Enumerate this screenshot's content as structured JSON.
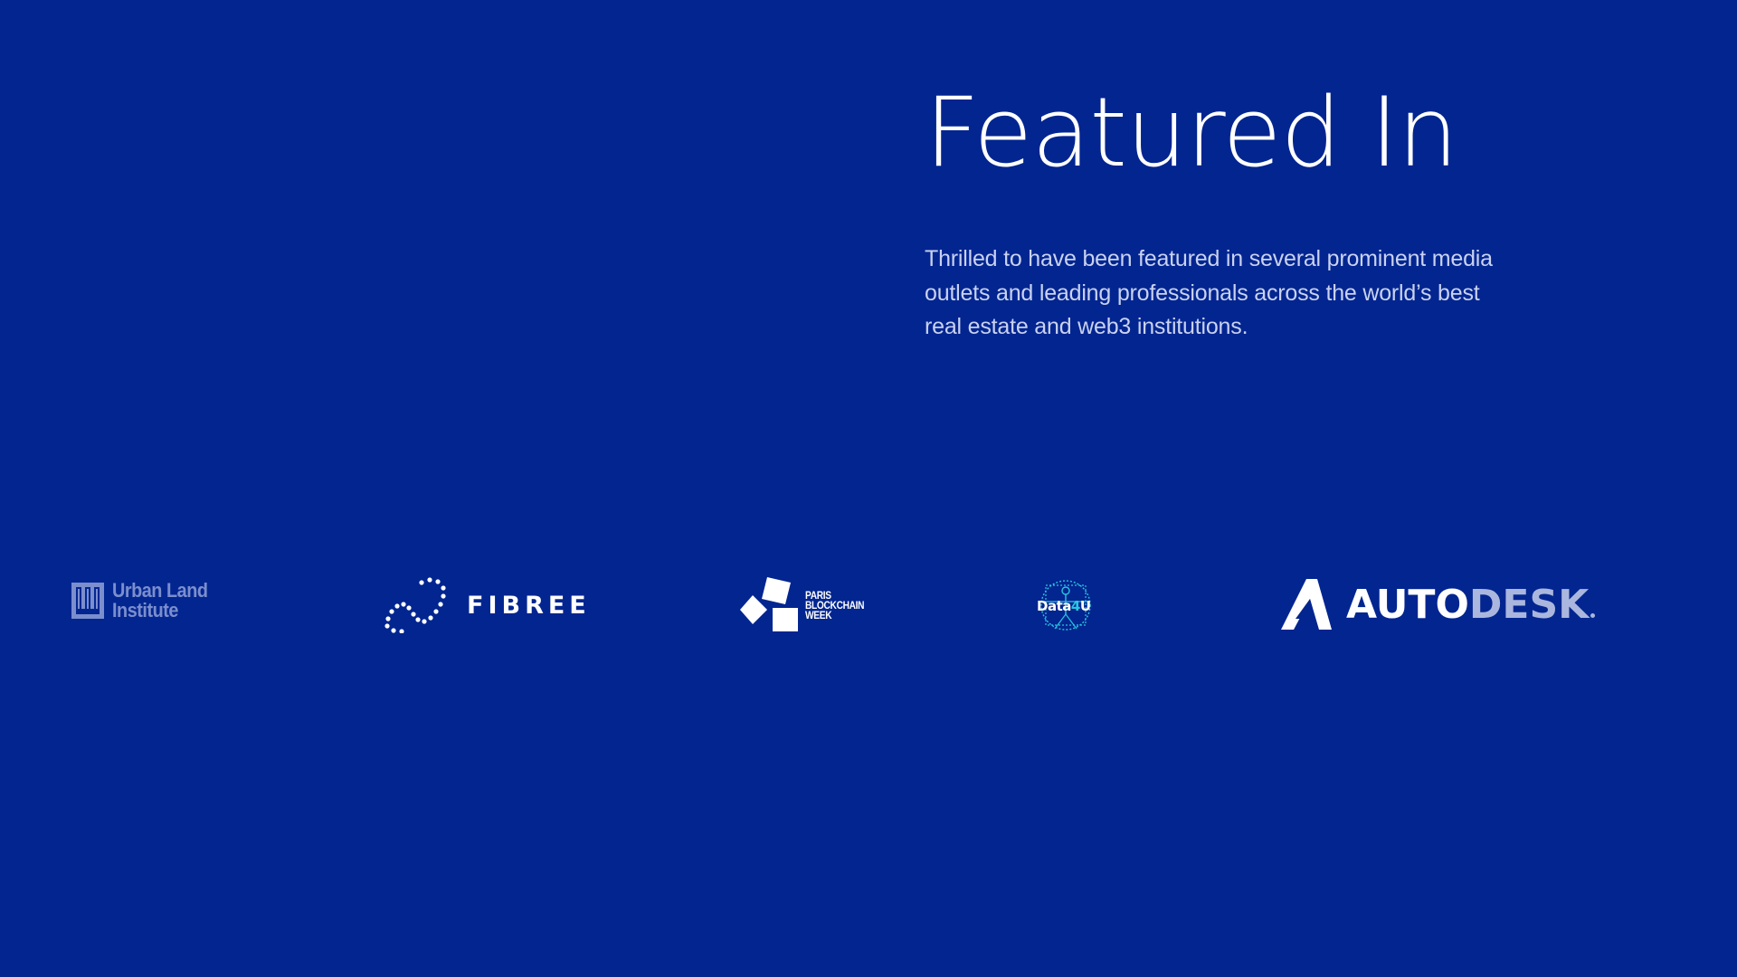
{
  "section": {
    "heading": "Featured In",
    "description": "Thrilled to have been featured in several prominent media outlets and leading professionals across the world’s best real estate and web3 institutions."
  },
  "logos": [
    {
      "name": "Urban Land Institute",
      "icon": "uli-icon",
      "lines": [
        "Urban Land",
        "Institute"
      ]
    },
    {
      "name": "FIBREE",
      "icon": "fibree-dots-icon",
      "text": "FIBREE"
    },
    {
      "name": "Paris Blockchain Week",
      "icon": "pbw-cubes-icon",
      "lines": [
        "PARIS",
        "BLOCKCHAIN",
        "WEEK"
      ]
    },
    {
      "name": "Data4U",
      "icon": "data4u-vitruvian-icon",
      "text_a": "Data",
      "text_b": "4",
      "text_c": "U"
    },
    {
      "name": "AUTODESK",
      "icon": "autodesk-a-icon",
      "text_a": "AUTO",
      "text_b": "DESK"
    }
  ],
  "colors": {
    "background": "#022590",
    "heading": "#ffffff",
    "description": "#c9d2f0",
    "accent_cyan": "#29c6e0"
  }
}
